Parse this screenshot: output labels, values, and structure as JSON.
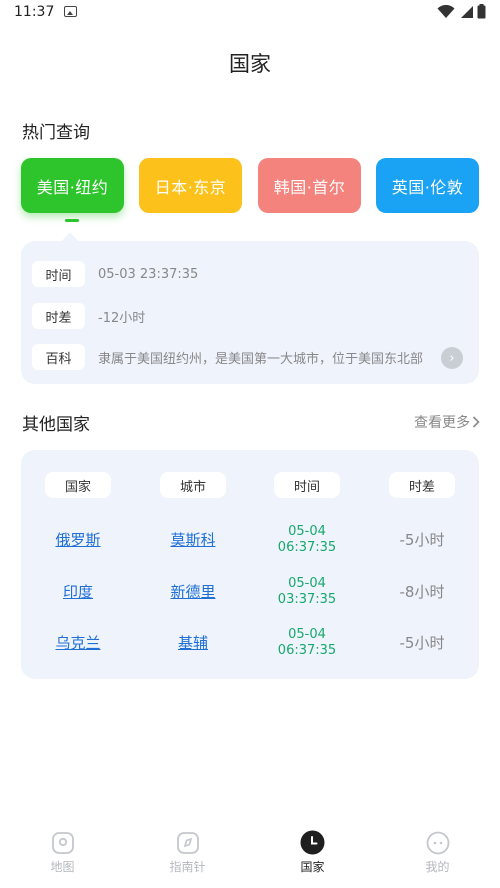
{
  "status_bar": {
    "time": "11:37"
  },
  "header": {
    "title": "国家"
  },
  "hot": {
    "title": "热门查询",
    "cities": [
      {
        "label": "美国·纽约",
        "color": "#2dc52b"
      },
      {
        "label": "日本·东京",
        "color": "#fcc21b"
      },
      {
        "label": "韩国·首尔",
        "color": "#f5837d"
      },
      {
        "label": "英国·伦敦",
        "color": "#1aa2f4"
      }
    ],
    "selected_index": 0,
    "info": [
      {
        "tag": "时间",
        "value": "05-03 23:37:35"
      },
      {
        "tag": "时差",
        "value": "-12小时"
      },
      {
        "tag": "百科",
        "value": "隶属于美国纽约州，是美国第一大城市，位于美国东北部"
      }
    ]
  },
  "other": {
    "title": "其他国家",
    "see_more": "查看更多",
    "headers": [
      "国家",
      "城市",
      "时间",
      "时差"
    ],
    "rows": [
      {
        "country": "俄罗斯",
        "city": "莫斯科",
        "date": "05-04",
        "time": "06:37:35",
        "diff": "-5小时"
      },
      {
        "country": "印度",
        "city": "新德里",
        "date": "05-04",
        "time": "03:37:35",
        "diff": "-8小时"
      },
      {
        "country": "乌克兰",
        "city": "基辅",
        "date": "05-04",
        "time": "06:37:35",
        "diff": "-5小时"
      }
    ]
  },
  "nav": {
    "items": [
      {
        "label": "地图",
        "icon": "map-icon"
      },
      {
        "label": "指南针",
        "icon": "compass-icon"
      },
      {
        "label": "国家",
        "icon": "clock-icon"
      },
      {
        "label": "我的",
        "icon": "profile-icon"
      }
    ],
    "active_index": 2
  }
}
